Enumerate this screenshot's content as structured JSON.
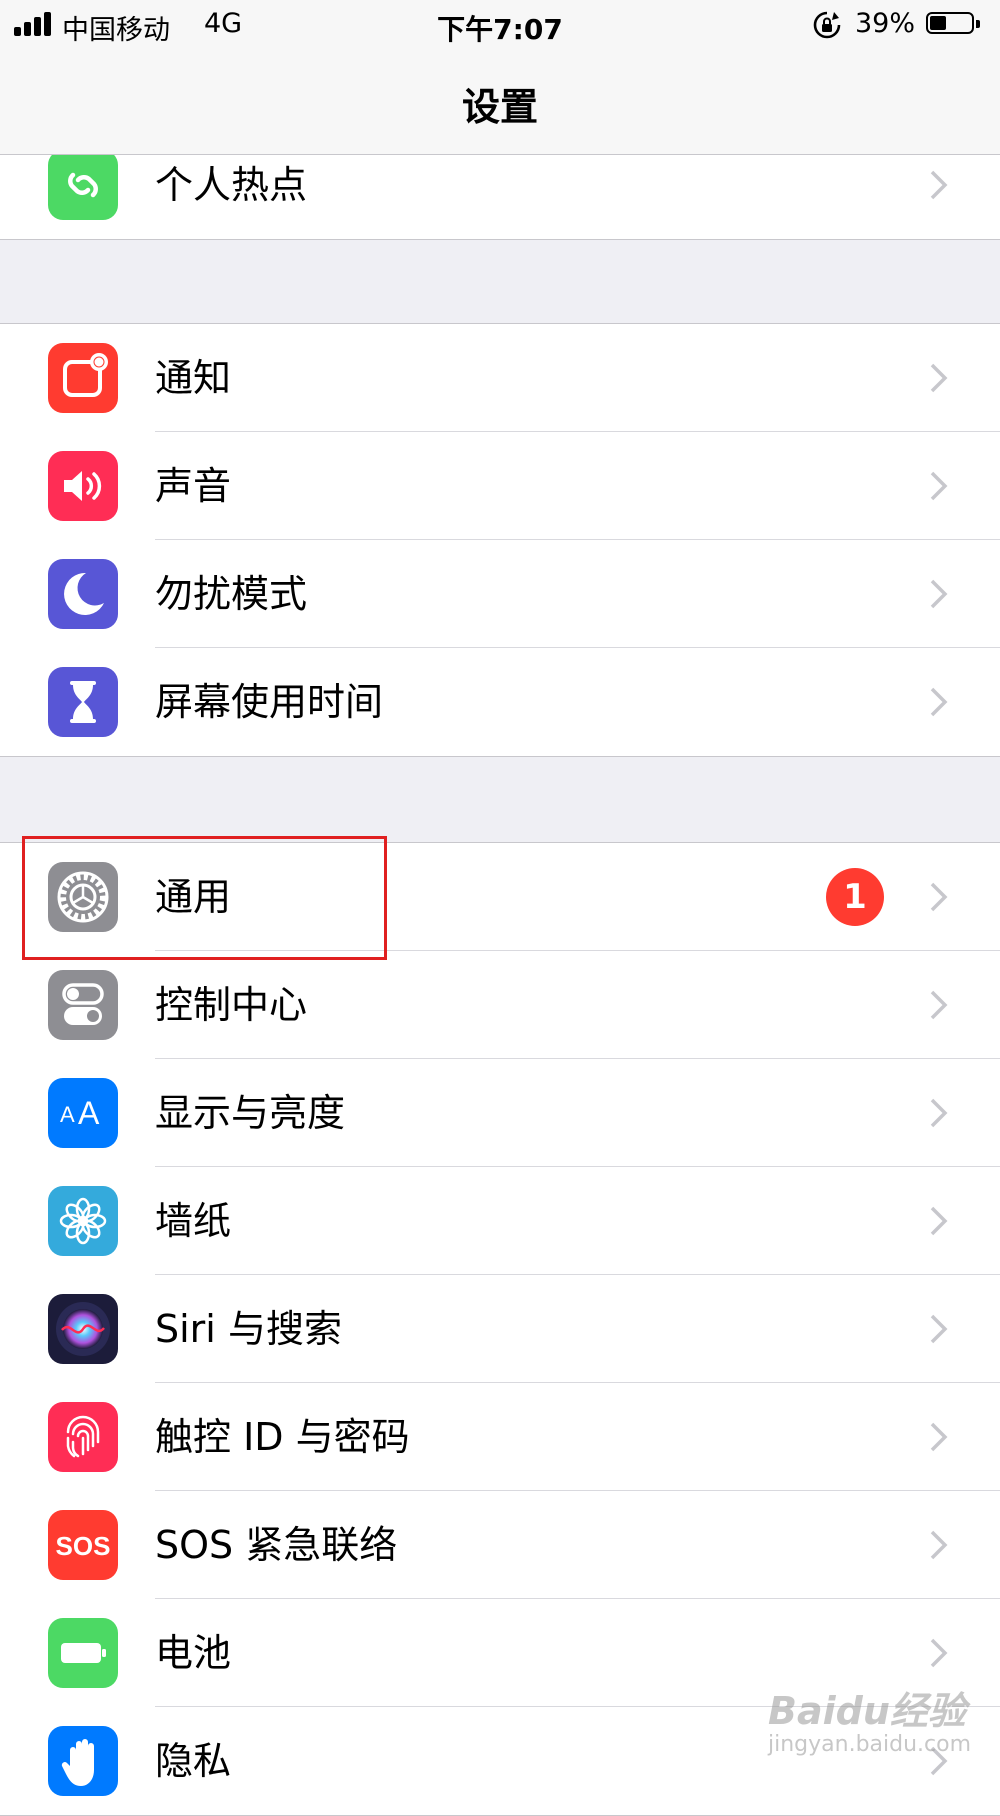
{
  "status_bar": {
    "carrier": "中国移动",
    "network": "4G",
    "time": "下午7:07",
    "battery_percent_label": "39%",
    "battery_level": 0.39
  },
  "nav": {
    "title": "设置"
  },
  "groups": [
    {
      "rows": [
        {
          "label": "个人热点",
          "icon": "hotspot-icon",
          "color": "#4cd964"
        }
      ]
    },
    {
      "rows": [
        {
          "label": "通知",
          "icon": "notifications-icon",
          "color": "#ff3b30"
        },
        {
          "label": "声音",
          "icon": "speaker-icon",
          "color": "#ff2d55"
        },
        {
          "label": "勿扰模式",
          "icon": "moon-icon",
          "color": "#5856d6"
        },
        {
          "label": "屏幕使用时间",
          "icon": "hourglass-icon",
          "color": "#5856d6"
        }
      ]
    },
    {
      "rows": [
        {
          "label": "通用",
          "icon": "gear-icon",
          "color": "#8e8e93",
          "badge": "1"
        },
        {
          "label": "控制中心",
          "icon": "toggles-icon",
          "color": "#8e8e93"
        },
        {
          "label": "显示与亮度",
          "icon": "text-size-icon",
          "color": "#007aff",
          "icon_text": "AA"
        },
        {
          "label": "墙纸",
          "icon": "flower-icon",
          "color": "#34aadc"
        },
        {
          "label": "Siri 与搜索",
          "icon": "siri-icon",
          "color": "#1c1c3a"
        },
        {
          "label": "触控 ID 与密码",
          "icon": "fingerprint-icon",
          "color": "#ff2d55"
        },
        {
          "label": "SOS 紧急联络",
          "icon": "sos-icon",
          "color": "#ff3b30",
          "icon_text": "SOS"
        },
        {
          "label": "电池",
          "icon": "battery-app-icon",
          "color": "#4cd964"
        },
        {
          "label": "隐私",
          "icon": "hand-icon",
          "color": "#007aff"
        }
      ]
    }
  ],
  "watermark": {
    "brand": "Baidu经验",
    "url": "jingyan.baidu.com"
  }
}
